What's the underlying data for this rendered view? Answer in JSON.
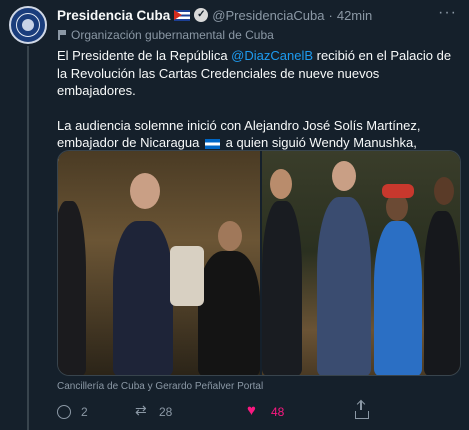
{
  "author": {
    "name": "Presidencia Cuba",
    "handle": "@PresidenciaCuba",
    "separator": "·",
    "time": "42min",
    "verified_icon": "verified-badge-icon",
    "flag_icon": "cuba-flag-icon",
    "label": "Organización gubernamental de Cuba"
  },
  "tweet": {
    "p1_pre": "El Presidente de la República ",
    "p1_mention": "@DiazCanelB",
    "p1_post": " recibió en el Palacio de la Revolución las Cartas Credenciales de nueve nuevos embajadores.",
    "p2_a": "La audiencia solemne inició con Alejandro José Solís Martínez, embajador de Nicaragua ",
    "p2_b": " a quien siguió Wendy Manushka, embajadora de Suriname ",
    "p2_c": "."
  },
  "media": {
    "caption": "Cancillería de Cuba y Gerardo Peñalver Portal",
    "photos": [
      "photo-credentials-handover",
      "photo-group-portrait"
    ]
  },
  "actions": {
    "replies": "2",
    "retweets": "28",
    "likes": "48"
  },
  "colors": {
    "background": "#15202b",
    "text": "#f7f9f9",
    "muted": "#8b98a5",
    "link": "#1d9bf0",
    "like": "#f91880"
  }
}
